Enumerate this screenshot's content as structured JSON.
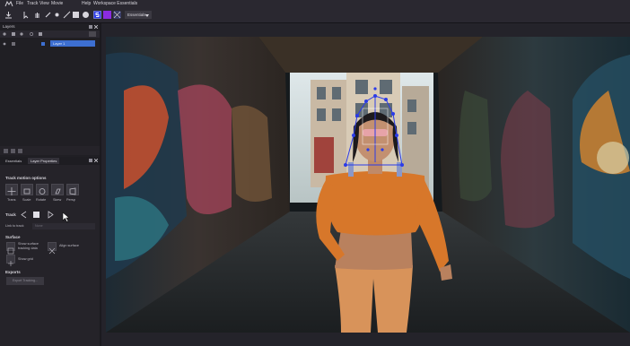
{
  "menu": {
    "items": [
      "File",
      "Track",
      "View",
      "Movie",
      "Help",
      "Workspace Essentials"
    ],
    "logo_icon": "mocha-logo-icon"
  },
  "toolbar": {
    "workspace_label": "Essentials",
    "icons": [
      "save-icon",
      "undo-icon",
      "select-icon",
      "hand-icon",
      "pen-icon",
      "spline-icon",
      "box-icon",
      "ellipse-icon",
      "s-icon",
      "color-swatch-icon",
      "transform-icon"
    ]
  },
  "layers_panel": {
    "title": "Layers",
    "layer_name": "Layer 1"
  },
  "tabs": [
    "Essentials",
    "Layer Properties"
  ],
  "track_motion": {
    "title": "Track motion options",
    "buttons": [
      "Trans",
      "Scale",
      "Rotate",
      "Skew",
      "Persp"
    ]
  },
  "track": {
    "label": "Track"
  },
  "link_to_track": {
    "label": "Link to track",
    "value": "None"
  },
  "surface": {
    "title": "Surface",
    "show_surface_label": "Show surface\ntracking data",
    "align_surface_label": "Align surface",
    "show_grid_label": "Show grid"
  },
  "exports": {
    "title": "Exports",
    "button_label": "Export Tracking..."
  },
  "colors": {
    "accent": "#3d6fd1",
    "tracking_points": "#2b3be8",
    "swatch_purple": "#8b2be0"
  }
}
